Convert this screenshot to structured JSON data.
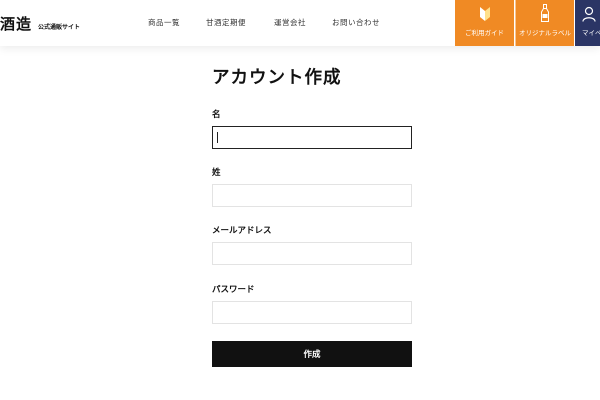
{
  "header": {
    "logo_main": "酒造",
    "logo_sub": "公式通販サイト",
    "nav": [
      {
        "label": "商品一覧"
      },
      {
        "label": "甘酒定期便"
      },
      {
        "label": "運営会社"
      },
      {
        "label": "お問い合わせ"
      }
    ],
    "buttons": {
      "guide": {
        "label": "ご利用ガイド",
        "icon": "beginner-mark-icon"
      },
      "label": {
        "label": "オリジナルラベル",
        "icon": "bottle-icon"
      },
      "mypage": {
        "label": "マイページ",
        "icon": "user-icon"
      }
    },
    "colors": {
      "accent": "#f08a24",
      "mypage": "#2b3565"
    }
  },
  "form": {
    "title": "アカウント作成",
    "fields": [
      {
        "label": "名",
        "value": "",
        "placeholder": ""
      },
      {
        "label": "姓",
        "value": "",
        "placeholder": ""
      },
      {
        "label": "メールアドレス",
        "value": "",
        "placeholder": ""
      },
      {
        "label": "パスワード",
        "value": "",
        "placeholder": ""
      }
    ],
    "submit_label": "作成"
  }
}
